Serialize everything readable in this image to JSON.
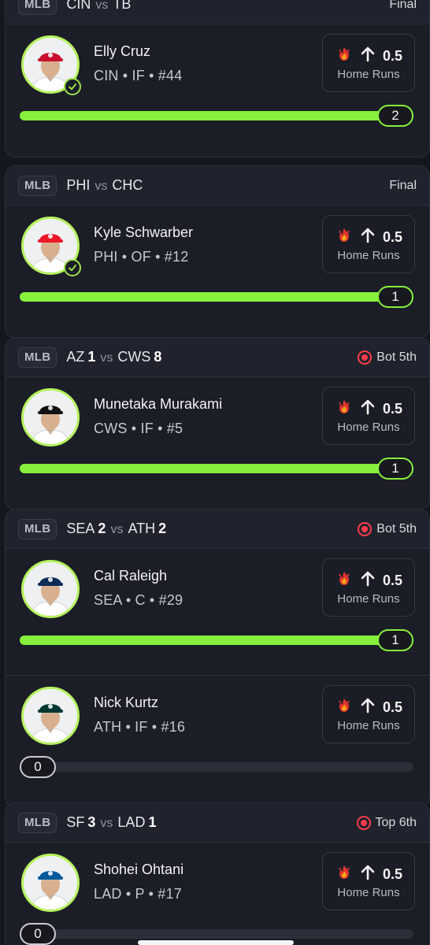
{
  "games": [
    {
      "league": "MLB",
      "home_team": "CIN",
      "home_score": "",
      "away_team": "TB",
      "away_score": "",
      "vs": "vs",
      "status": "Final",
      "live": false,
      "players": [
        {
          "name": "Elly Cruz",
          "meta": "CIN • IF • #44",
          "line": "0.5",
          "direction_icon": "arrow-up-icon",
          "stat": "Home Runs",
          "value": "2",
          "progress": 1.0,
          "checked": true,
          "cap_color": "#c8102e",
          "avatar_icon": "reds-cap-icon"
        }
      ]
    },
    {
      "league": "MLB",
      "home_team": "PHI",
      "home_score": "",
      "away_team": "CHC",
      "away_score": "",
      "vs": "vs",
      "status": "Final",
      "live": false,
      "players": [
        {
          "name": "Kyle Schwarber",
          "meta": "PHI • OF • #12",
          "line": "0.5",
          "direction_icon": "arrow-up-icon",
          "stat": "Home Runs",
          "value": "1",
          "progress": 1.0,
          "checked": true,
          "cap_color": "#e81828",
          "avatar_icon": "phillies-cap-icon"
        }
      ]
    },
    {
      "league": "MLB",
      "home_team": "AZ",
      "home_score": "1",
      "away_team": "CWS",
      "away_score": "8",
      "vs": "vs",
      "status": "Bot 5th",
      "live": true,
      "players": [
        {
          "name": "Munetaka Murakami",
          "meta": "CWS • IF • #5",
          "line": "0.5",
          "direction_icon": "arrow-up-icon",
          "stat": "Home Runs",
          "value": "1",
          "progress": 1.0,
          "checked": false,
          "cap_color": "#111111",
          "avatar_icon": "white-sox-cap-icon"
        }
      ]
    },
    {
      "league": "MLB",
      "home_team": "SEA",
      "home_score": "2",
      "away_team": "ATH",
      "away_score": "2",
      "vs": "vs",
      "status": "Bot 5th",
      "live": true,
      "players": [
        {
          "name": "Cal Raleigh",
          "meta": "SEA • C • #29",
          "line": "0.5",
          "direction_icon": "arrow-up-icon",
          "stat": "Home Runs",
          "value": "1",
          "progress": 1.0,
          "checked": false,
          "cap_color": "#0c2c56",
          "avatar_icon": "mariners-cap-icon"
        },
        {
          "name": "Nick Kurtz",
          "meta": "ATH • IF • #16",
          "line": "0.5",
          "direction_icon": "arrow-up-icon",
          "stat": "Home Runs",
          "value": "0",
          "progress": 0.0,
          "checked": false,
          "cap_color": "#003831",
          "avatar_icon": "athletics-cap-icon"
        }
      ]
    },
    {
      "league": "MLB",
      "home_team": "SF",
      "home_score": "3",
      "away_team": "LAD",
      "away_score": "1",
      "vs": "vs",
      "status": "Top 6th",
      "live": true,
      "players": [
        {
          "name": "Shohei Ohtani",
          "meta": "LAD • P • #17",
          "line": "0.5",
          "direction_icon": "arrow-up-icon",
          "stat": "Home Runs",
          "value": "0",
          "progress": 0.0,
          "checked": false,
          "cap_color": "#005a9c",
          "avatar_icon": "dodgers-cap-icon"
        }
      ]
    }
  ],
  "colors": {
    "progress": "#86f03c",
    "live": "#ff3b4a",
    "ring": "#b6f25d",
    "background": "#15171e"
  },
  "icons": {
    "prop_flame": "flame-icon",
    "check": "check-icon",
    "live": "live-dot-icon"
  }
}
